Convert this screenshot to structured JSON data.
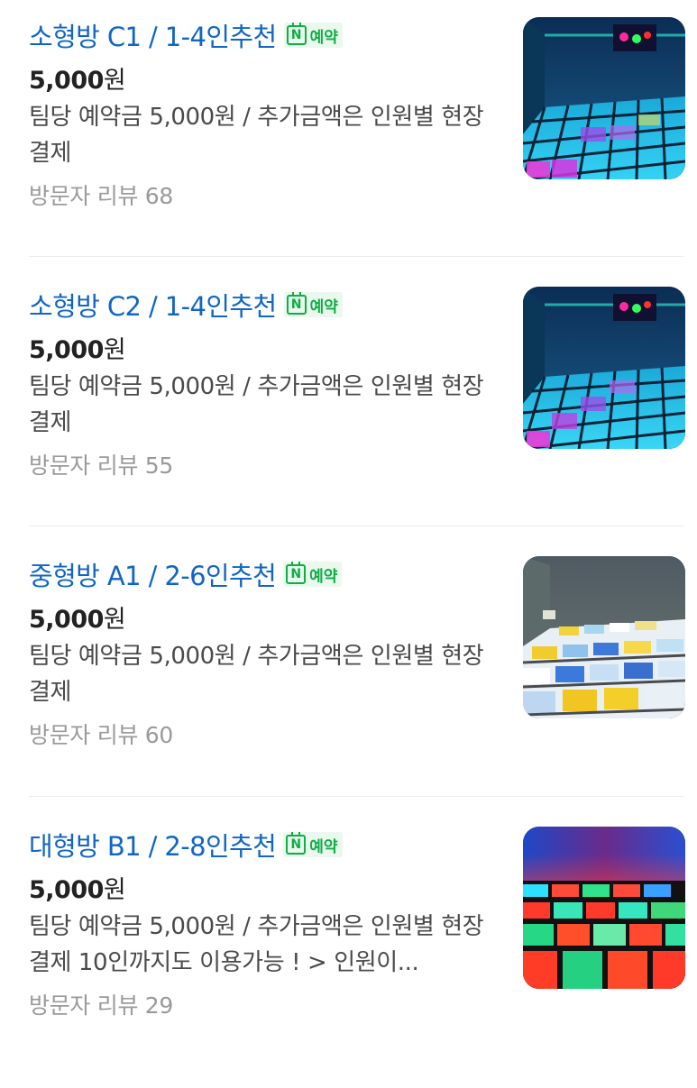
{
  "items": [
    {
      "title": "소형방 C1 / 1-4인추천",
      "badge": "예약",
      "price_number": "5,000",
      "price_unit": "원",
      "description": "팀당 예약금 5,000원 / 추가금액은 인원별 현장결제",
      "reviews": "방문자 리뷰 68",
      "thumbnail_desc": "small room with neon LED floor"
    },
    {
      "title": "소형방 C2 / 1-4인추천",
      "badge": "예약",
      "price_number": "5,000",
      "price_unit": "원",
      "description": "팀당 예약금 5,000원 / 추가금액은 인원별 현장결제",
      "reviews": "방문자 리뷰 55",
      "thumbnail_desc": "small room with neon LED floor"
    },
    {
      "title": "중형방 A1 / 2-6인추천",
      "badge": "예약",
      "price_number": "5,000",
      "price_unit": "원",
      "description": "팀당 예약금 5,000원 / 추가금액은 인원별 현장결제",
      "reviews": "방문자 리뷰 60",
      "thumbnail_desc": "medium room with colored LED floor tiles"
    },
    {
      "title": "대형방 B1 / 2-8인추천",
      "badge": "예약",
      "price_number": "5,000",
      "price_unit": "원",
      "description": "팀당 예약금 5,000원 / 추가금액은 인원별 현장결제 10인까지도 이용가능 ! > 인원이...",
      "reviews": "방문자 리뷰 29",
      "thumbnail_desc": "large room with red, green and blue LED floor"
    }
  ],
  "colors": {
    "title": "#1166c4",
    "naver_green": "#0dae45",
    "review_gray": "#9a9a9a"
  },
  "icons": {
    "booking_badge": "naver-booking-calendar-icon"
  }
}
